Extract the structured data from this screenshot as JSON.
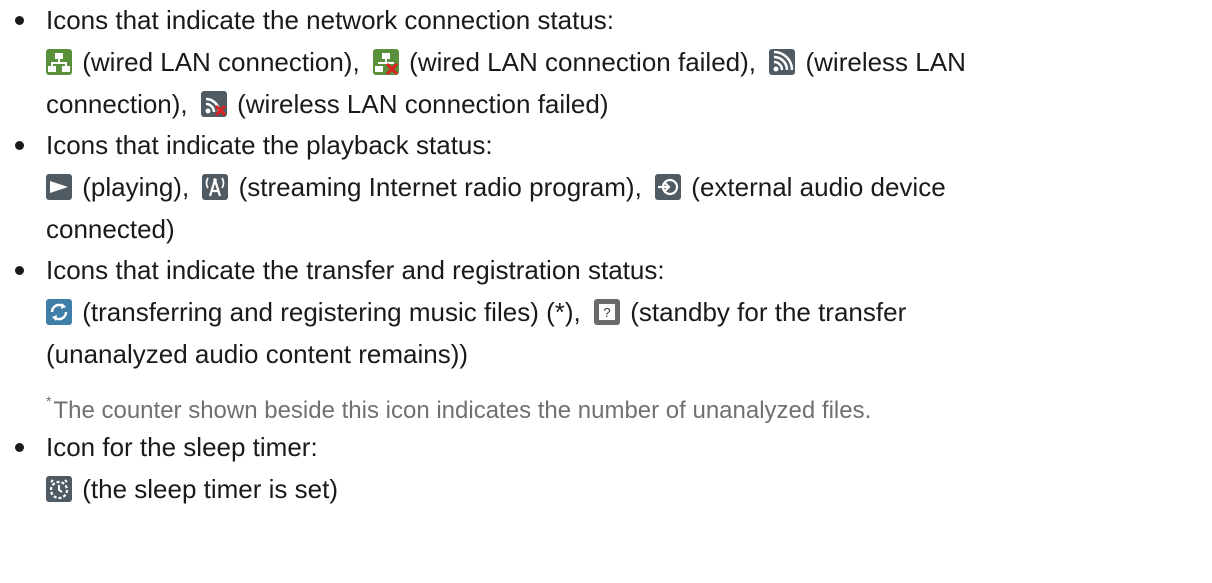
{
  "sections": [
    {
      "heading": "Icons that indicate the network connection status:",
      "items": [
        {
          "icon": "wired-lan-icon",
          "text": "(wired LAN connection),"
        },
        {
          "icon": "wired-lan-failed-icon",
          "text": "(wired LAN connection failed),"
        },
        {
          "icon": "wireless-lan-icon",
          "text": "(wireless LAN"
        },
        {
          "text": "connection),"
        },
        {
          "icon": "wireless-lan-failed-icon",
          "text": "(wireless LAN connection failed)"
        }
      ]
    },
    {
      "heading": "Icons that indicate the playback status:",
      "items": [
        {
          "icon": "playing-icon",
          "text": "(playing),"
        },
        {
          "icon": "streaming-radio-icon",
          "text": "(streaming Internet radio program),"
        },
        {
          "icon": "external-audio-icon",
          "text": "(external audio device"
        },
        {
          "text": "connected)"
        }
      ]
    },
    {
      "heading": "Icons that indicate the transfer and registration status:",
      "items": [
        {
          "icon": "transfer-icon",
          "text": "(transferring and registering music files) (*),"
        },
        {
          "icon": "standby-icon",
          "text": "(standby for the transfer"
        },
        {
          "text": "(unanalyzed audio content remains))"
        }
      ]
    },
    {
      "heading": "Icon for the sleep timer:",
      "items": [
        {
          "icon": "sleep-timer-icon",
          "text": "(the sleep timer is set)"
        }
      ]
    }
  ],
  "footnote": {
    "marker": "*",
    "text": "The counter shown beside this icon indicates the number of unanalyzed files."
  }
}
